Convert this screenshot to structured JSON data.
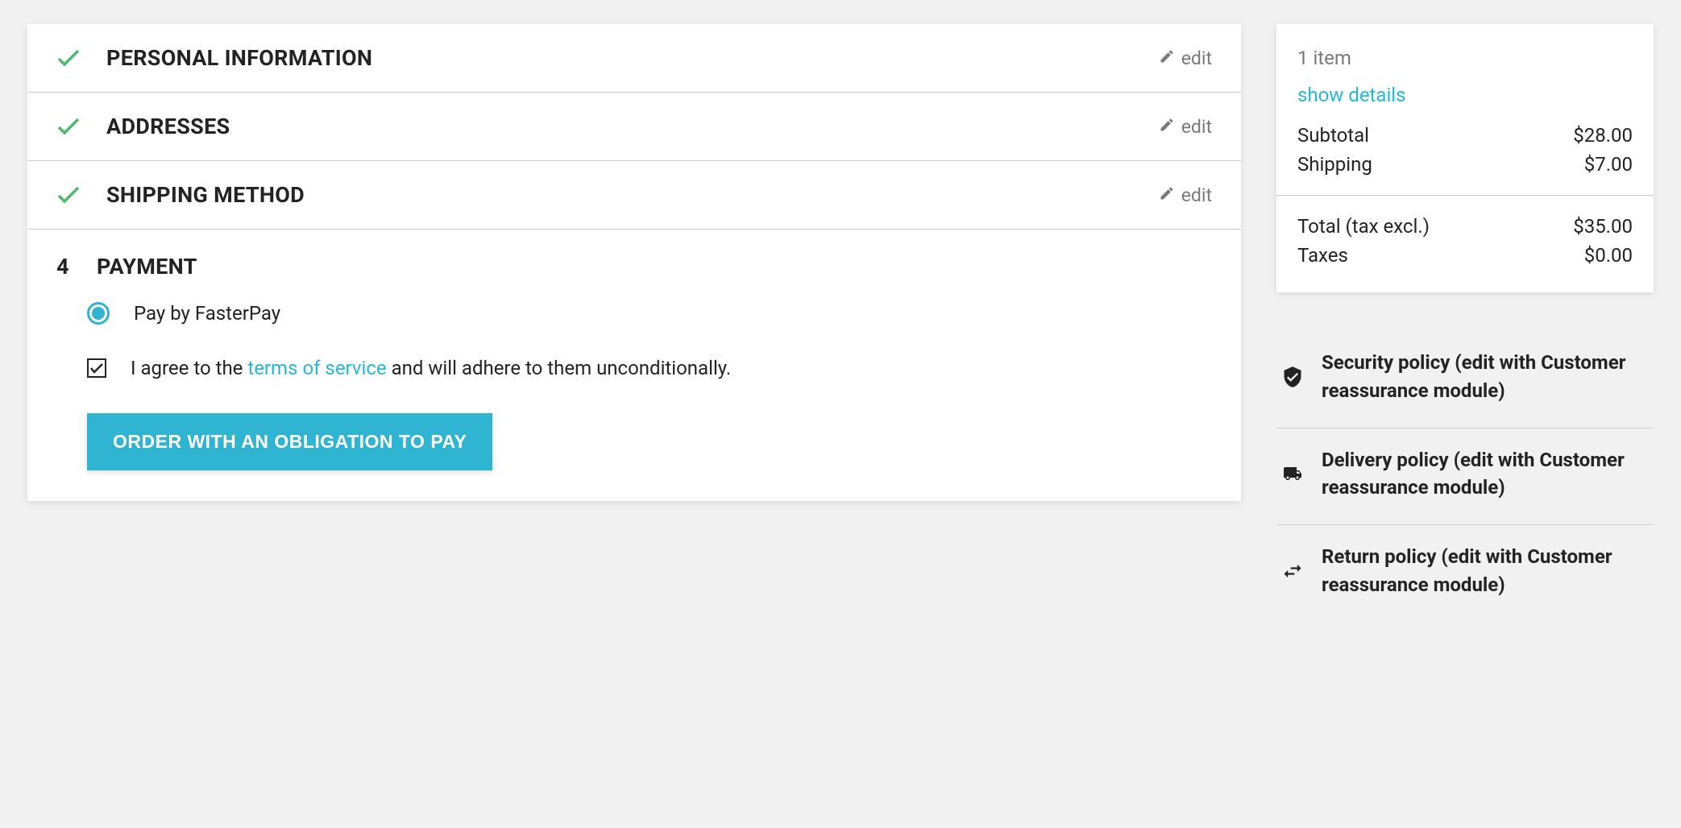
{
  "steps": {
    "personal_info": {
      "title": "PERSONAL INFORMATION",
      "edit_label": "edit"
    },
    "addresses": {
      "title": "ADDRESSES",
      "edit_label": "edit"
    },
    "shipping": {
      "title": "SHIPPING METHOD",
      "edit_label": "edit"
    },
    "payment": {
      "number": "4",
      "title": "PAYMENT",
      "option_label": "Pay by FasterPay",
      "terms_prefix": "I agree to the ",
      "terms_link": "terms of service",
      "terms_suffix": " and will adhere to them unconditionally.",
      "order_button": "ORDER WITH AN OBLIGATION TO PAY"
    }
  },
  "summary": {
    "items_label": "1 item",
    "show_details": "show details",
    "subtotal_label": "Subtotal",
    "subtotal_value": "$28.00",
    "shipping_label": "Shipping",
    "shipping_value": "$7.00",
    "total_label": "Total (tax excl.)",
    "total_value": "$35.00",
    "taxes_label": "Taxes",
    "taxes_value": "$0.00"
  },
  "reassurance": {
    "security": "Security policy (edit with Customer reassurance module)",
    "delivery": "Delivery policy (edit with Customer reassurance module)",
    "return": "Return policy (edit with Customer reassurance module)"
  }
}
